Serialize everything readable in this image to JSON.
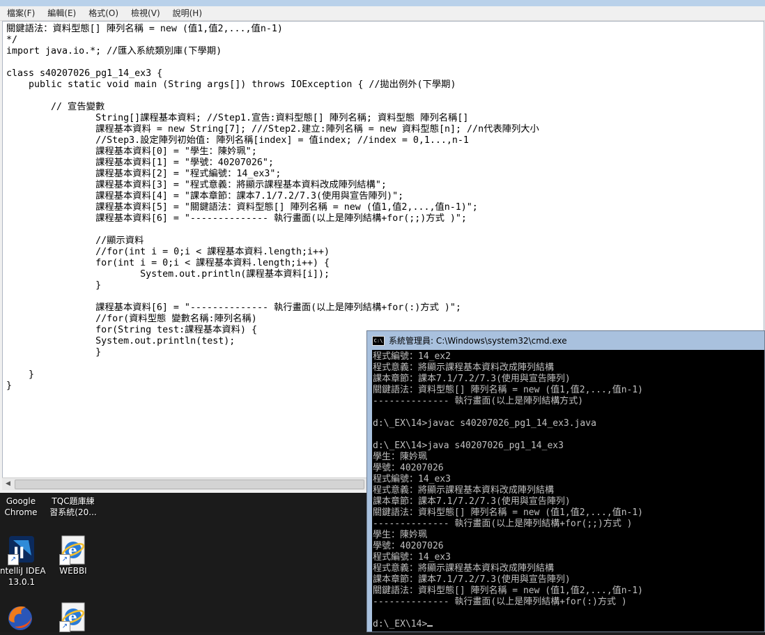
{
  "notepad": {
    "menu": [
      "檔案(F)",
      "編輯(E)",
      "格式(O)",
      "檢視(V)",
      "說明(H)"
    ],
    "code_lines": [
      "關鍵語法：資料型態[] 陣列名稱 = new (值1,值2,...,值n-1)",
      "*/",
      "import java.io.*; //匯入系統類別庫(下學期)",
      "",
      "class s40207026_pg1_14_ex3 {",
      "    public static void main (String args[]) throws IOException { //拋出例外(下學期)",
      "",
      "        // 宣告變數",
      "                String[]課程基本資料; //Step1.宣告:資料型態[] 陣列名稱; 資料型態 陣列名稱[]",
      "                課程基本資料 = new String[7]; ///Step2.建立:陣列名稱 = new 資料型態[n]; //n代表陣列大小",
      "                //Step3.設定陣列初始值: 陣列名稱[index] = 值index; //index = 0,1...,n-1",
      "                課程基本資料[0] = \"學生：陳妗珮\";",
      "                課程基本資料[1] = \"學號：40207026\";",
      "                課程基本資料[2] = \"程式編號：14_ex3\";",
      "                課程基本資料[3] = \"程式意義：將顯示課程基本資料改成陣列結構\";",
      "                課程基本資料[4] = \"課本章節：課本7.1/7.2/7.3(使用與宣告陣列)\";",
      "                課程基本資料[5] = \"關鍵語法：資料型態[] 陣列名稱 = new (值1,值2,...,值n-1)\";",
      "                課程基本資料[6] = \"-------------- 執行畫面(以上是陣列結構+for(;;)方式 )\";",
      "",
      "                //顯示資料",
      "                //for(int i = 0;i < 課程基本資料.length;i++)",
      "                for(int i = 0;i < 課程基本資料.length;i++) {",
      "                        System.out.println(課程基本資料[i]);",
      "                }",
      "",
      "                課程基本資料[6] = \"-------------- 執行畫面(以上是陣列結構+for(:)方式 )\";",
      "                //for(資料型態 變數名稱:陣列名稱)",
      "                for(String test:課程基本資料) {",
      "                System.out.println(test);",
      "                }",
      "",
      "    }",
      "}"
    ]
  },
  "desktop": {
    "icons": [
      {
        "name": "chrome",
        "label_lines": [
          "Google",
          "Chrome"
        ]
      },
      {
        "name": "tqc",
        "label_lines": [
          "TQC題庫練",
          "習系統(20..."
        ]
      },
      {
        "name": "intellij",
        "label_lines": [
          "IntelliJ IDEA",
          "13.0.1"
        ]
      },
      {
        "name": "webbi",
        "label_lines": [
          "WEBBI"
        ]
      },
      {
        "name": "firefox",
        "label_lines": []
      },
      {
        "name": "ie",
        "label_lines": []
      }
    ]
  },
  "cmd": {
    "title": "系統管理員: C:\\Windows\\system32\\cmd.exe",
    "icon_text": "C:\\",
    "lines": [
      "程式編號：14_ex2",
      "程式意義：將顯示課程基本資料改成陣列結構",
      "課本章節：課本7.1/7.2/7.3(使用與宣告陣列)",
      "關鍵語法：資料型態[] 陣列名稱 = new (值1,值2,...,值n-1)",
      "-------------- 執行畫面(以上是陣列結構方式)",
      "",
      "d:\\_EX\\14>javac s40207026_pg1_14_ex3.java",
      "",
      "d:\\_EX\\14>java s40207026_pg1_14_ex3",
      "學生：陳妗珮",
      "學號：40207026",
      "程式編號：14_ex3",
      "程式意義：將顯示課程基本資料改成陣列結構",
      "課本章節：課本7.1/7.2/7.3(使用與宣告陣列)",
      "關鍵語法：資料型態[] 陣列名稱 = new (值1,值2,...,值n-1)",
      "-------------- 執行畫面(以上是陣列結構+for(;;)方式 )",
      "學生：陳妗珮",
      "學號：40207026",
      "程式編號：14_ex3",
      "程式意義：將顯示課程基本資料改成陣列結構",
      "課本章節：課本7.1/7.2/7.3(使用與宣告陣列)",
      "關鍵語法：資料型態[] 陣列名稱 = new (值1,值2,...,值n-1)",
      "-------------- 執行畫面(以上是陣列結構+for(:)方式 )",
      ""
    ],
    "prompt": "d:\\_EX\\14>"
  }
}
